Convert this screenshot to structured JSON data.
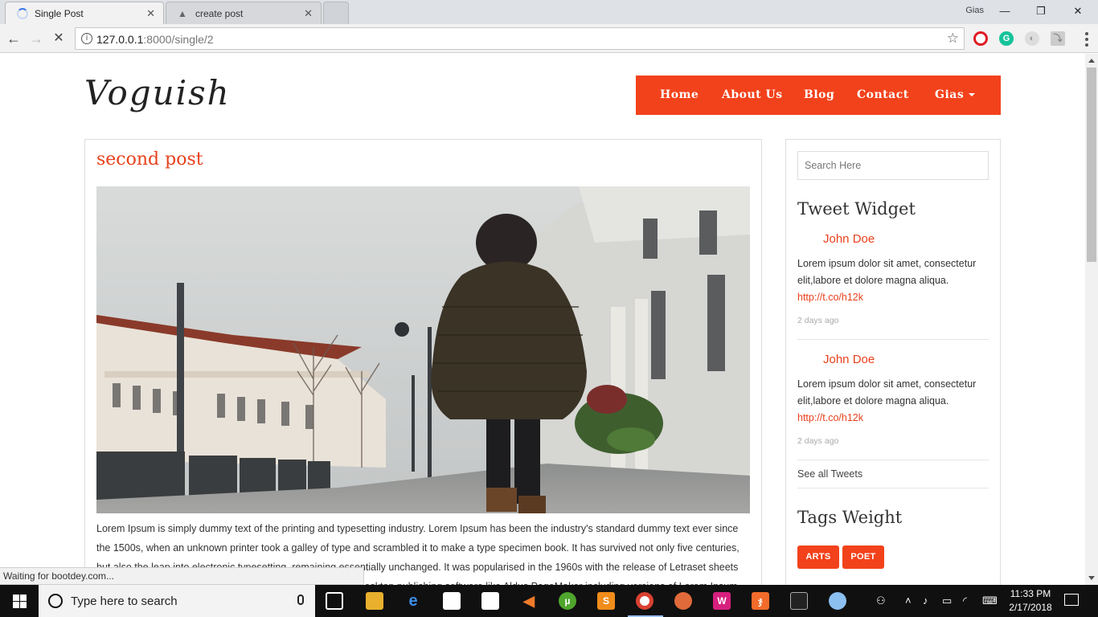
{
  "browser": {
    "tabs": [
      {
        "title": "Single Post",
        "state": "loading"
      },
      {
        "title": "create post",
        "state": "idle"
      }
    ],
    "profile_name": "Gias",
    "url_host": "127.0.0.1",
    "url_rest": ":8000/single/2",
    "status_text": "Waiting for bootdey.com..."
  },
  "site": {
    "logo": "Voguish",
    "nav": [
      {
        "label": "Home"
      },
      {
        "label": "About Us"
      },
      {
        "label": "Blog"
      },
      {
        "label": "Contact"
      },
      {
        "label": "Gias"
      }
    ],
    "accent_color": "#f2421b"
  },
  "post": {
    "title": "second post",
    "body": "Lorem Ipsum is simply dummy text of the printing and typesetting industry. Lorem Ipsum has been the industry's standard dummy text ever since the 1500s, when an unknown printer took a galley of type and scrambled it to make a type specimen book. It has survived not only five centuries, but also the leap into electronic typesetting, remaining essentially unchanged. It was popularised in the 1960s with the release of Letraset sheets containing Lorem Ipsum passages, and more recently with desktop publishing software like Aldus PageMaker including versions of Lorem Ipsum."
  },
  "sidebar": {
    "search_placeholder": "Search Here",
    "tweet_widget_title": "Tweet Widget",
    "tweets": [
      {
        "name": "John Doe",
        "text": "Lorem ipsum dolor sit amet, consectetur elit,labore et dolore magna aliqua.",
        "link": "http://t.co/h12k",
        "time": "2 days ago"
      },
      {
        "name": "John Doe",
        "text": "Lorem ipsum dolor sit amet, consectetur elit,labore et dolore magna aliqua.",
        "link": "http://t.co/h12k",
        "time": "2 days ago"
      }
    ],
    "see_all": "See all Tweets",
    "tags_title": "Tags Weight",
    "tags": [
      "ARTS",
      "POET"
    ]
  },
  "taskbar": {
    "search_placeholder": "Type here to search",
    "time": "11:33 PM",
    "date": "2/17/2018"
  }
}
